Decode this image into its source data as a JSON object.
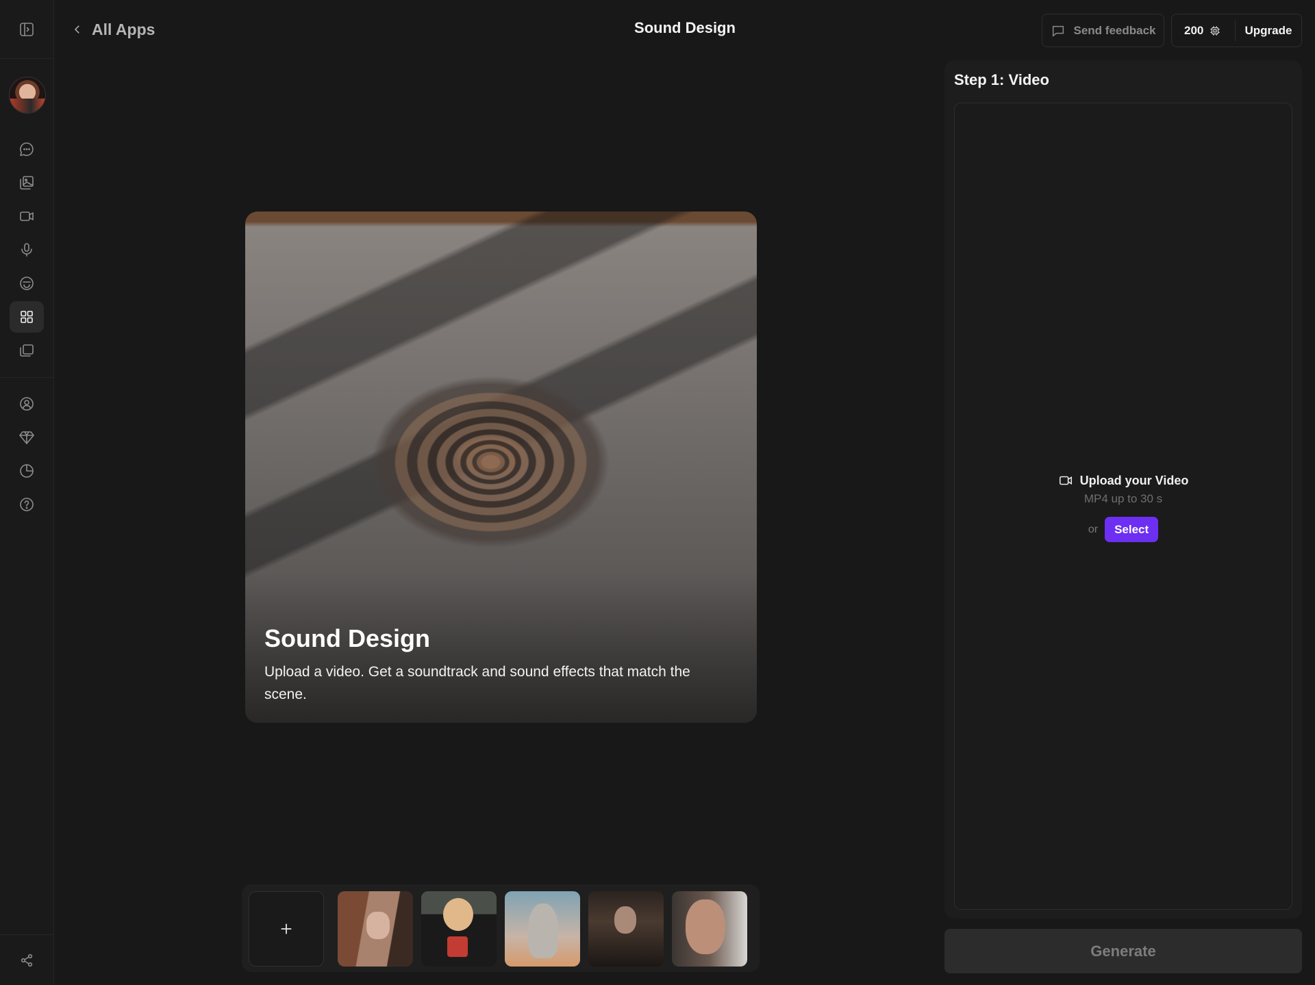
{
  "header": {
    "back_label": "All Apps",
    "title": "Sound Design",
    "feedback_label": "Send feedback",
    "credits": "200",
    "upgrade_label": "Upgrade"
  },
  "sidebar": {
    "icons": [
      "sidebar-toggle-icon",
      "chat-icon",
      "image-gallery-icon",
      "video-camera-icon",
      "microphone-icon",
      "smiley-icon",
      "apps-grid-icon",
      "collection-icon",
      "profile-icon",
      "gem-icon",
      "usage-chart-icon",
      "help-icon",
      "share-icon"
    ],
    "active": "apps-grid-icon"
  },
  "hero": {
    "title": "Sound Design",
    "description": "Upload a video. Get a soundtrack and sound effects that match the scene."
  },
  "thumbnails": {
    "count": 5,
    "add_icon": "plus-icon"
  },
  "panel": {
    "step_title": "Step 1: Video",
    "upload_title": "Upload your Video",
    "upload_subtitle": "MP4 up to 30 s",
    "or_label": "or",
    "select_label": "Select"
  },
  "generate_label": "Generate",
  "colors": {
    "background": "#181818",
    "accent": "#6d2ff2",
    "panel": "#1d1d1d"
  }
}
